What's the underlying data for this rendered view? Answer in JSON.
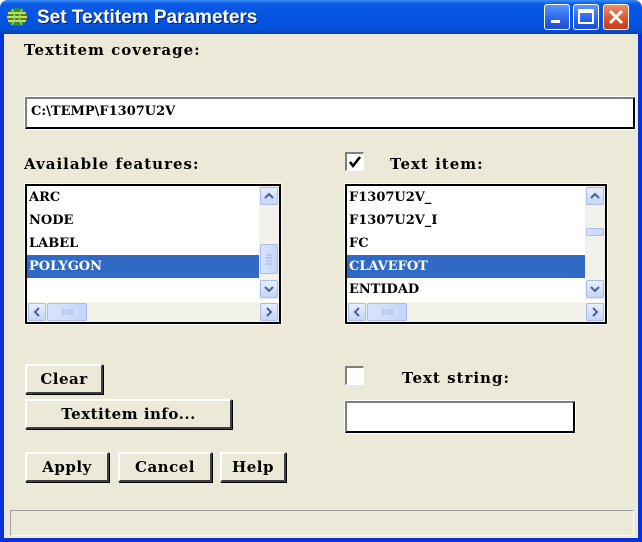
{
  "window": {
    "title": "Set Textitem Parameters",
    "buttons": [
      "minimize",
      "maximize",
      "close"
    ]
  },
  "coverage": {
    "label": "Textitem coverage:",
    "value": "C:\\TEMP\\F1307U2V"
  },
  "available_features": {
    "label": "Available features:",
    "items": [
      "ARC",
      "NODE",
      "LABEL",
      "POLYGON"
    ],
    "selected": "POLYGON"
  },
  "text_item": {
    "checkbox_checked": true,
    "label": "Text item:",
    "items": [
      "F1307U2V_",
      "F1307U2V_I",
      "FC",
      "CLAVEFOT",
      "ENTIDAD"
    ],
    "selected": "CLAVEFOT"
  },
  "text_string": {
    "checkbox_checked": false,
    "label": "Text string:",
    "value": ""
  },
  "buttons": {
    "clear": "Clear",
    "textitem_info": "Textitem info...",
    "apply": "Apply",
    "cancel": "Cancel",
    "help": "Help"
  },
  "status": {
    "text": ""
  },
  "colors": {
    "titlebar": "#0554e3",
    "dialog_bg": "#ece9d8",
    "selection": "#316ac5"
  }
}
